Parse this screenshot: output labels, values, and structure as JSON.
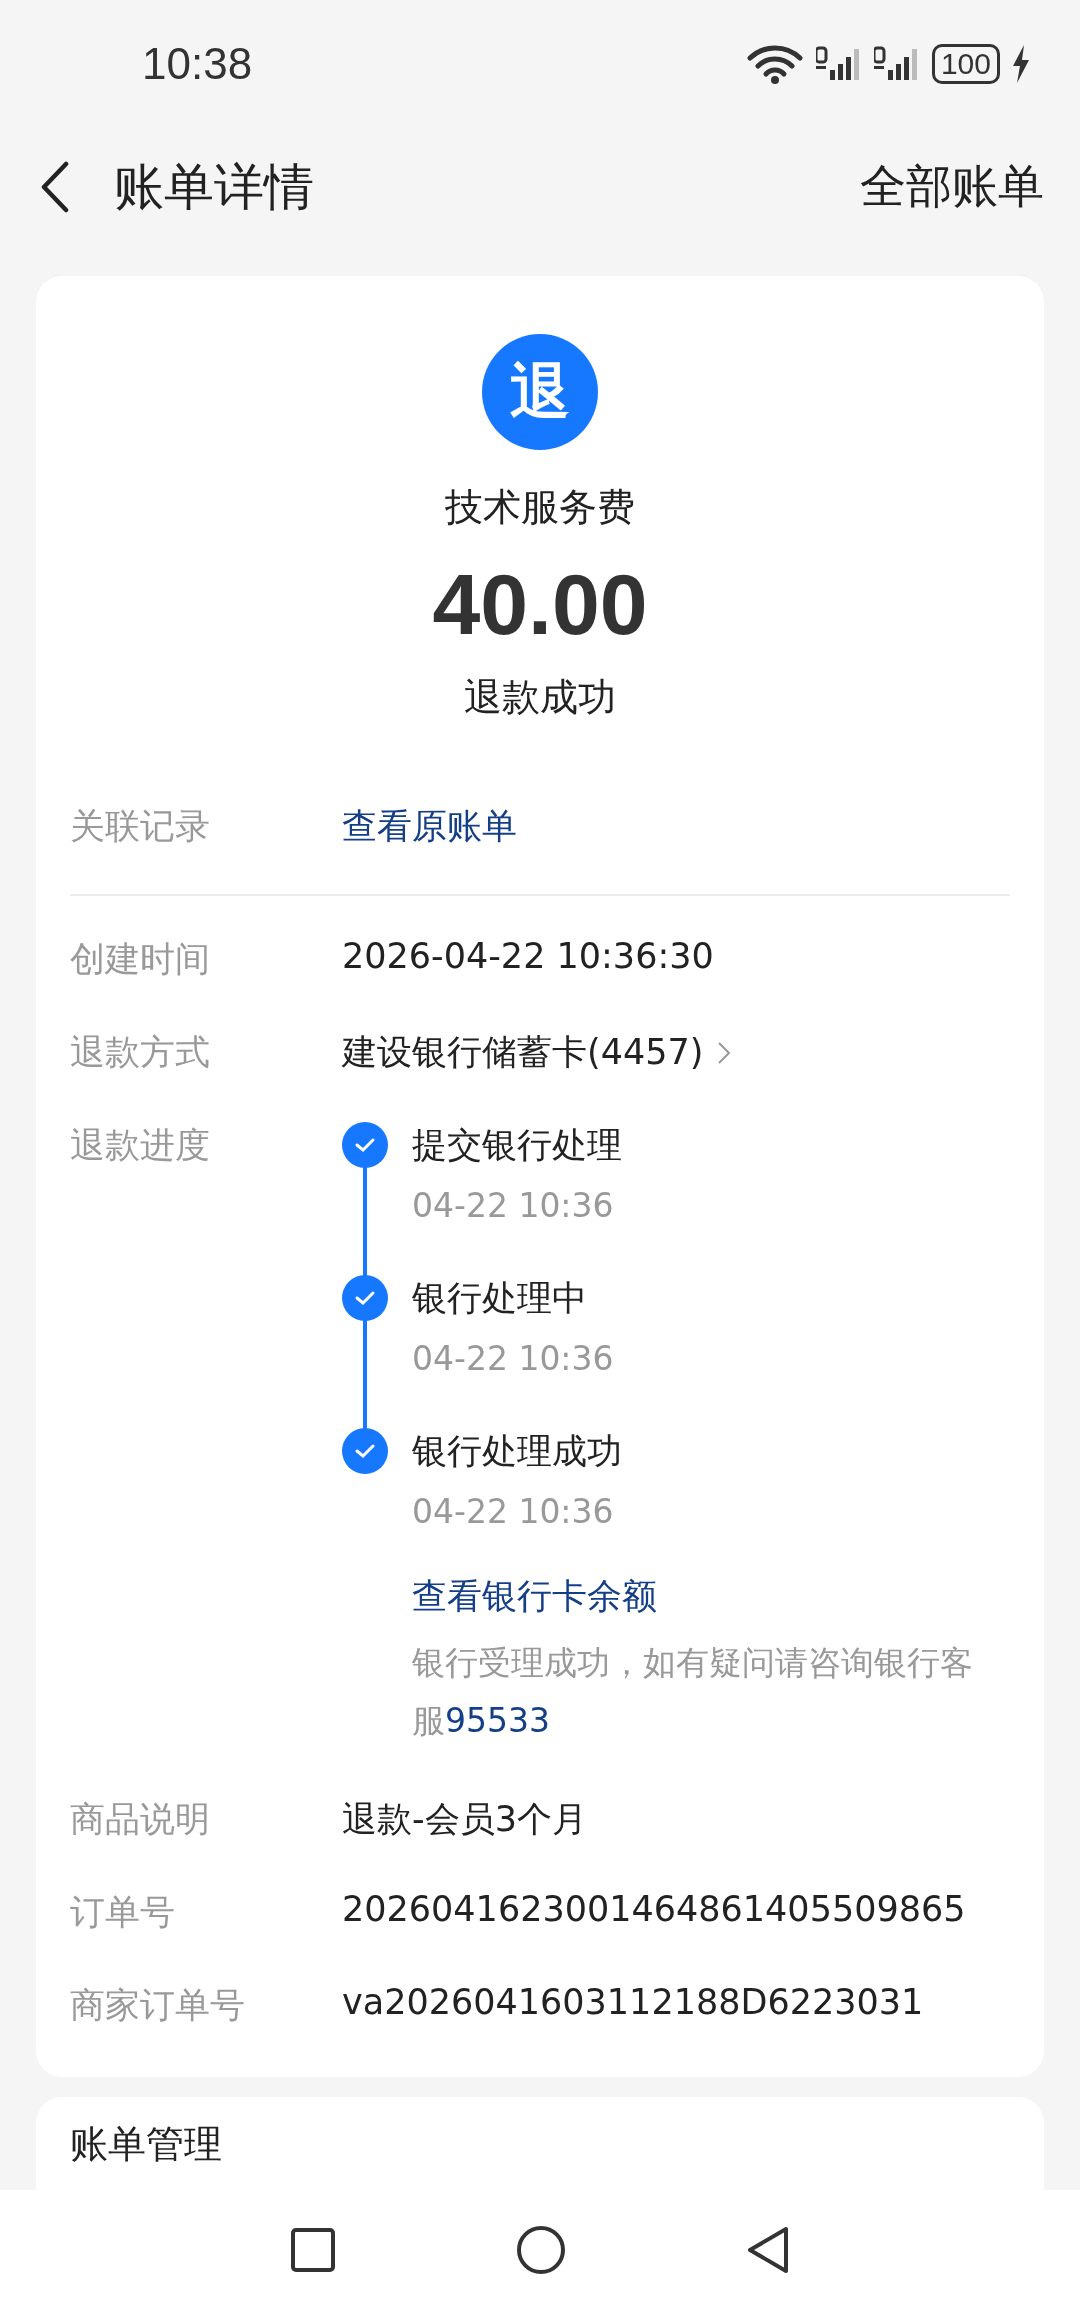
{
  "status_bar": {
    "time": "10:38",
    "battery": "100",
    "charging": true
  },
  "header": {
    "title": "账单详情",
    "action": "全部账单"
  },
  "summary": {
    "icon_text": "退",
    "merchant": "技术服务费",
    "amount": "40.00",
    "status": "退款成功"
  },
  "related": {
    "label": "关联记录",
    "link": "查看原账单"
  },
  "details": [
    {
      "kind": "text",
      "label": "创建时间",
      "value": "2026-04-22 10:36:30"
    },
    {
      "kind": "link",
      "label": "退款方式",
      "value": "建设银行储蓄卡(4457)"
    },
    {
      "kind": "progress",
      "label": "退款进度",
      "steps": [
        {
          "title": "提交银行处理",
          "time": "04-22 10:36",
          "done": true
        },
        {
          "title": "银行处理中",
          "time": "04-22 10:36",
          "done": true
        },
        {
          "title": "银行处理成功",
          "time": "04-22 10:36",
          "done": true
        }
      ],
      "balance_link": "查看银行卡余额",
      "note": "银行受理成功，如有疑问请咨询银行客服",
      "phone": "95533"
    },
    {
      "kind": "text",
      "label": "商品说明",
      "value": "退款-会员3个月"
    },
    {
      "kind": "text",
      "label": "订单号",
      "value": "2026041623001464861405509865"
    },
    {
      "kind": "text",
      "label": "商家订单号",
      "value": "va2026041603112188D6223031"
    }
  ],
  "manage": {
    "title": "账单管理"
  }
}
